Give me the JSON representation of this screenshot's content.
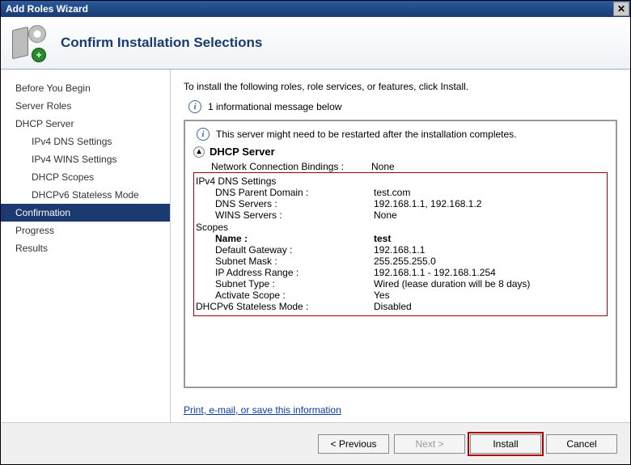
{
  "title": "Add Roles Wizard",
  "header": {
    "heading": "Confirm Installation Selections"
  },
  "sidebar": {
    "items": [
      {
        "label": "Before You Begin",
        "indent": 0
      },
      {
        "label": "Server Roles",
        "indent": 0
      },
      {
        "label": "DHCP Server",
        "indent": 0
      },
      {
        "label": "IPv4 DNS Settings",
        "indent": 1
      },
      {
        "label": "IPv4 WINS Settings",
        "indent": 1
      },
      {
        "label": "DHCP Scopes",
        "indent": 1
      },
      {
        "label": "DHCPv6 Stateless Mode",
        "indent": 1
      },
      {
        "label": "Confirmation",
        "indent": 0,
        "selected": true
      },
      {
        "label": "Progress",
        "indent": 0
      },
      {
        "label": "Results",
        "indent": 0
      }
    ]
  },
  "content": {
    "intro": "To install the following roles, role services, or features, click Install.",
    "info_count_msg": "1 informational message below",
    "restart_msg": "This server might need to be restarted after the installation completes.",
    "role_section": "DHCP Server",
    "bindings": {
      "label": "Network Connection Bindings :",
      "value": "None"
    },
    "ipv4_dns": {
      "heading": "IPv4 DNS Settings",
      "parent_domain": {
        "label": "DNS Parent Domain :",
        "value": "test.com"
      },
      "dns_servers": {
        "label": "DNS Servers :",
        "value": "192.168.1.1, 192.168.1.2"
      },
      "wins_servers": {
        "label": "WINS Servers :",
        "value": "None"
      }
    },
    "scopes": {
      "heading": "Scopes",
      "name": {
        "label": "Name :",
        "value": "test"
      },
      "gateway": {
        "label": "Default Gateway :",
        "value": "192.168.1.1"
      },
      "mask": {
        "label": "Subnet Mask :",
        "value": "255.255.255.0"
      },
      "range": {
        "label": "IP Address Range :",
        "value": "192.168.1.1 - 192.168.1.254"
      },
      "type": {
        "label": "Subnet Type :",
        "value": "Wired (lease duration will be 8 days)"
      },
      "activate": {
        "label": "Activate Scope :",
        "value": "Yes"
      }
    },
    "stateless": {
      "label": "DHCPv6 Stateless Mode :",
      "value": "Disabled"
    },
    "link": "Print, e-mail, or save this information"
  },
  "buttons": {
    "previous": "< Previous",
    "next": "Next >",
    "install": "Install",
    "cancel": "Cancel"
  }
}
